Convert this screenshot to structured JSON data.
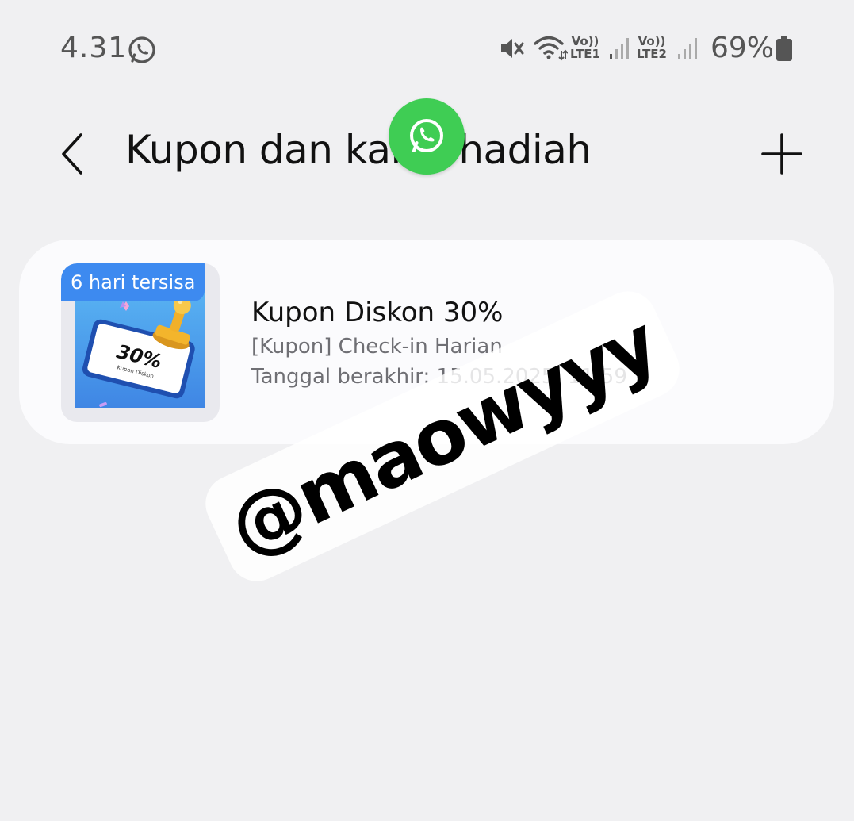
{
  "status_bar": {
    "time": "4.31",
    "sim1_vo": "Vo))",
    "sim1_label": "LTE1",
    "sim2_vo": "Vo))",
    "sim2_label": "LTE2",
    "battery": "69%"
  },
  "header": {
    "title": "Kupon dan kartu hadiah"
  },
  "coupon": {
    "badge": "6 hari tersisa",
    "thumb_value": "30%",
    "thumb_caption": "Kupon Diskon",
    "title": "Kupon Diskon 30%",
    "source": "[Kupon] Check-in Harian",
    "expiry": "Tanggal berakhir: 15.05.2025, 11:59"
  },
  "watermark": "@maowyyy",
  "colors": {
    "background": "#f0f0f2",
    "card": "#fbfbfd",
    "badge": "#3d8af0",
    "whatsapp_green": "#3fcd54"
  }
}
